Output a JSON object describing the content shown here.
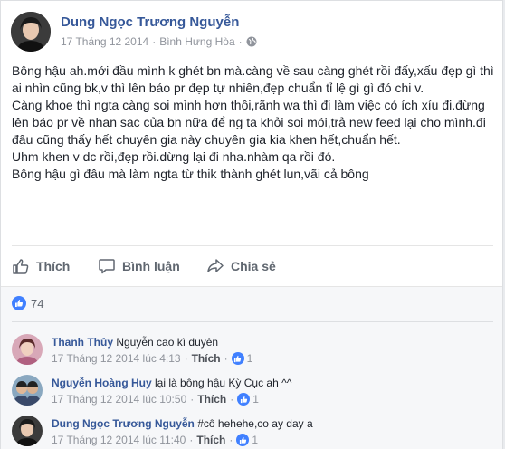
{
  "post": {
    "author": "Dung Ngọc Trương Nguyễn",
    "date": "17 Tháng 12 2014",
    "separator": "·",
    "location": "Bình Hưng Hòa",
    "paragraphs": [
      "Bông hậu ah.mới đầu mình k ghét bn mà.càng về sau càng ghét rồi đấy,xấu đẹp gì thì ai nhìn cũng bk,v thì lên báo pr đẹp tự nhiên,đẹp chuẩn tỉ lệ gì gì đó chi v.",
      "Càng khoe thì ngta càng soi mình hơn thôi,rãnh wa thì đi làm việc có ích xíu đi.đừng lên báo pr về nhan sac của bn nữa để ng ta khỏi soi mói,trả new feed lại cho mình.đi đâu cũng thấy hết chuyên gia này chuyên gia kia khen hết,chuẩn hết.",
      "Uhm khen v dc rồi,đẹp rồi.dừng lại đi nha.nhàm qa rồi đó.",
      "Bông hậu gì đâu mà làm ngta từ thik thành ghét lun,vãi cả bông"
    ]
  },
  "actions": {
    "like": "Thích",
    "comment": "Bình luận",
    "share": "Chia sẻ"
  },
  "reactions": {
    "count": "74"
  },
  "comments": [
    {
      "name": "Thanh Thủy",
      "text": "Nguyễn cao kì duyên",
      "time": "17 Tháng 12 2014 lúc 4:13",
      "like_label": "Thích",
      "likes": "1"
    },
    {
      "name": "Nguyễn Hoàng Huy",
      "text": "lại là bông hậu Kỳ Cục ah ^^",
      "time": "17 Tháng 12 2014 lúc 10:50",
      "like_label": "Thích",
      "likes": "1"
    },
    {
      "name": "Dung Ngọc Trương Nguyễn",
      "text": "#cô hehehe,co ay day a",
      "time": "17 Tháng 12 2014 lúc 11:40",
      "like_label": "Thích",
      "likes": "1"
    }
  ],
  "colors": {
    "link": "#365899",
    "like_blue": "#4080ff",
    "muted": "#90949c"
  }
}
